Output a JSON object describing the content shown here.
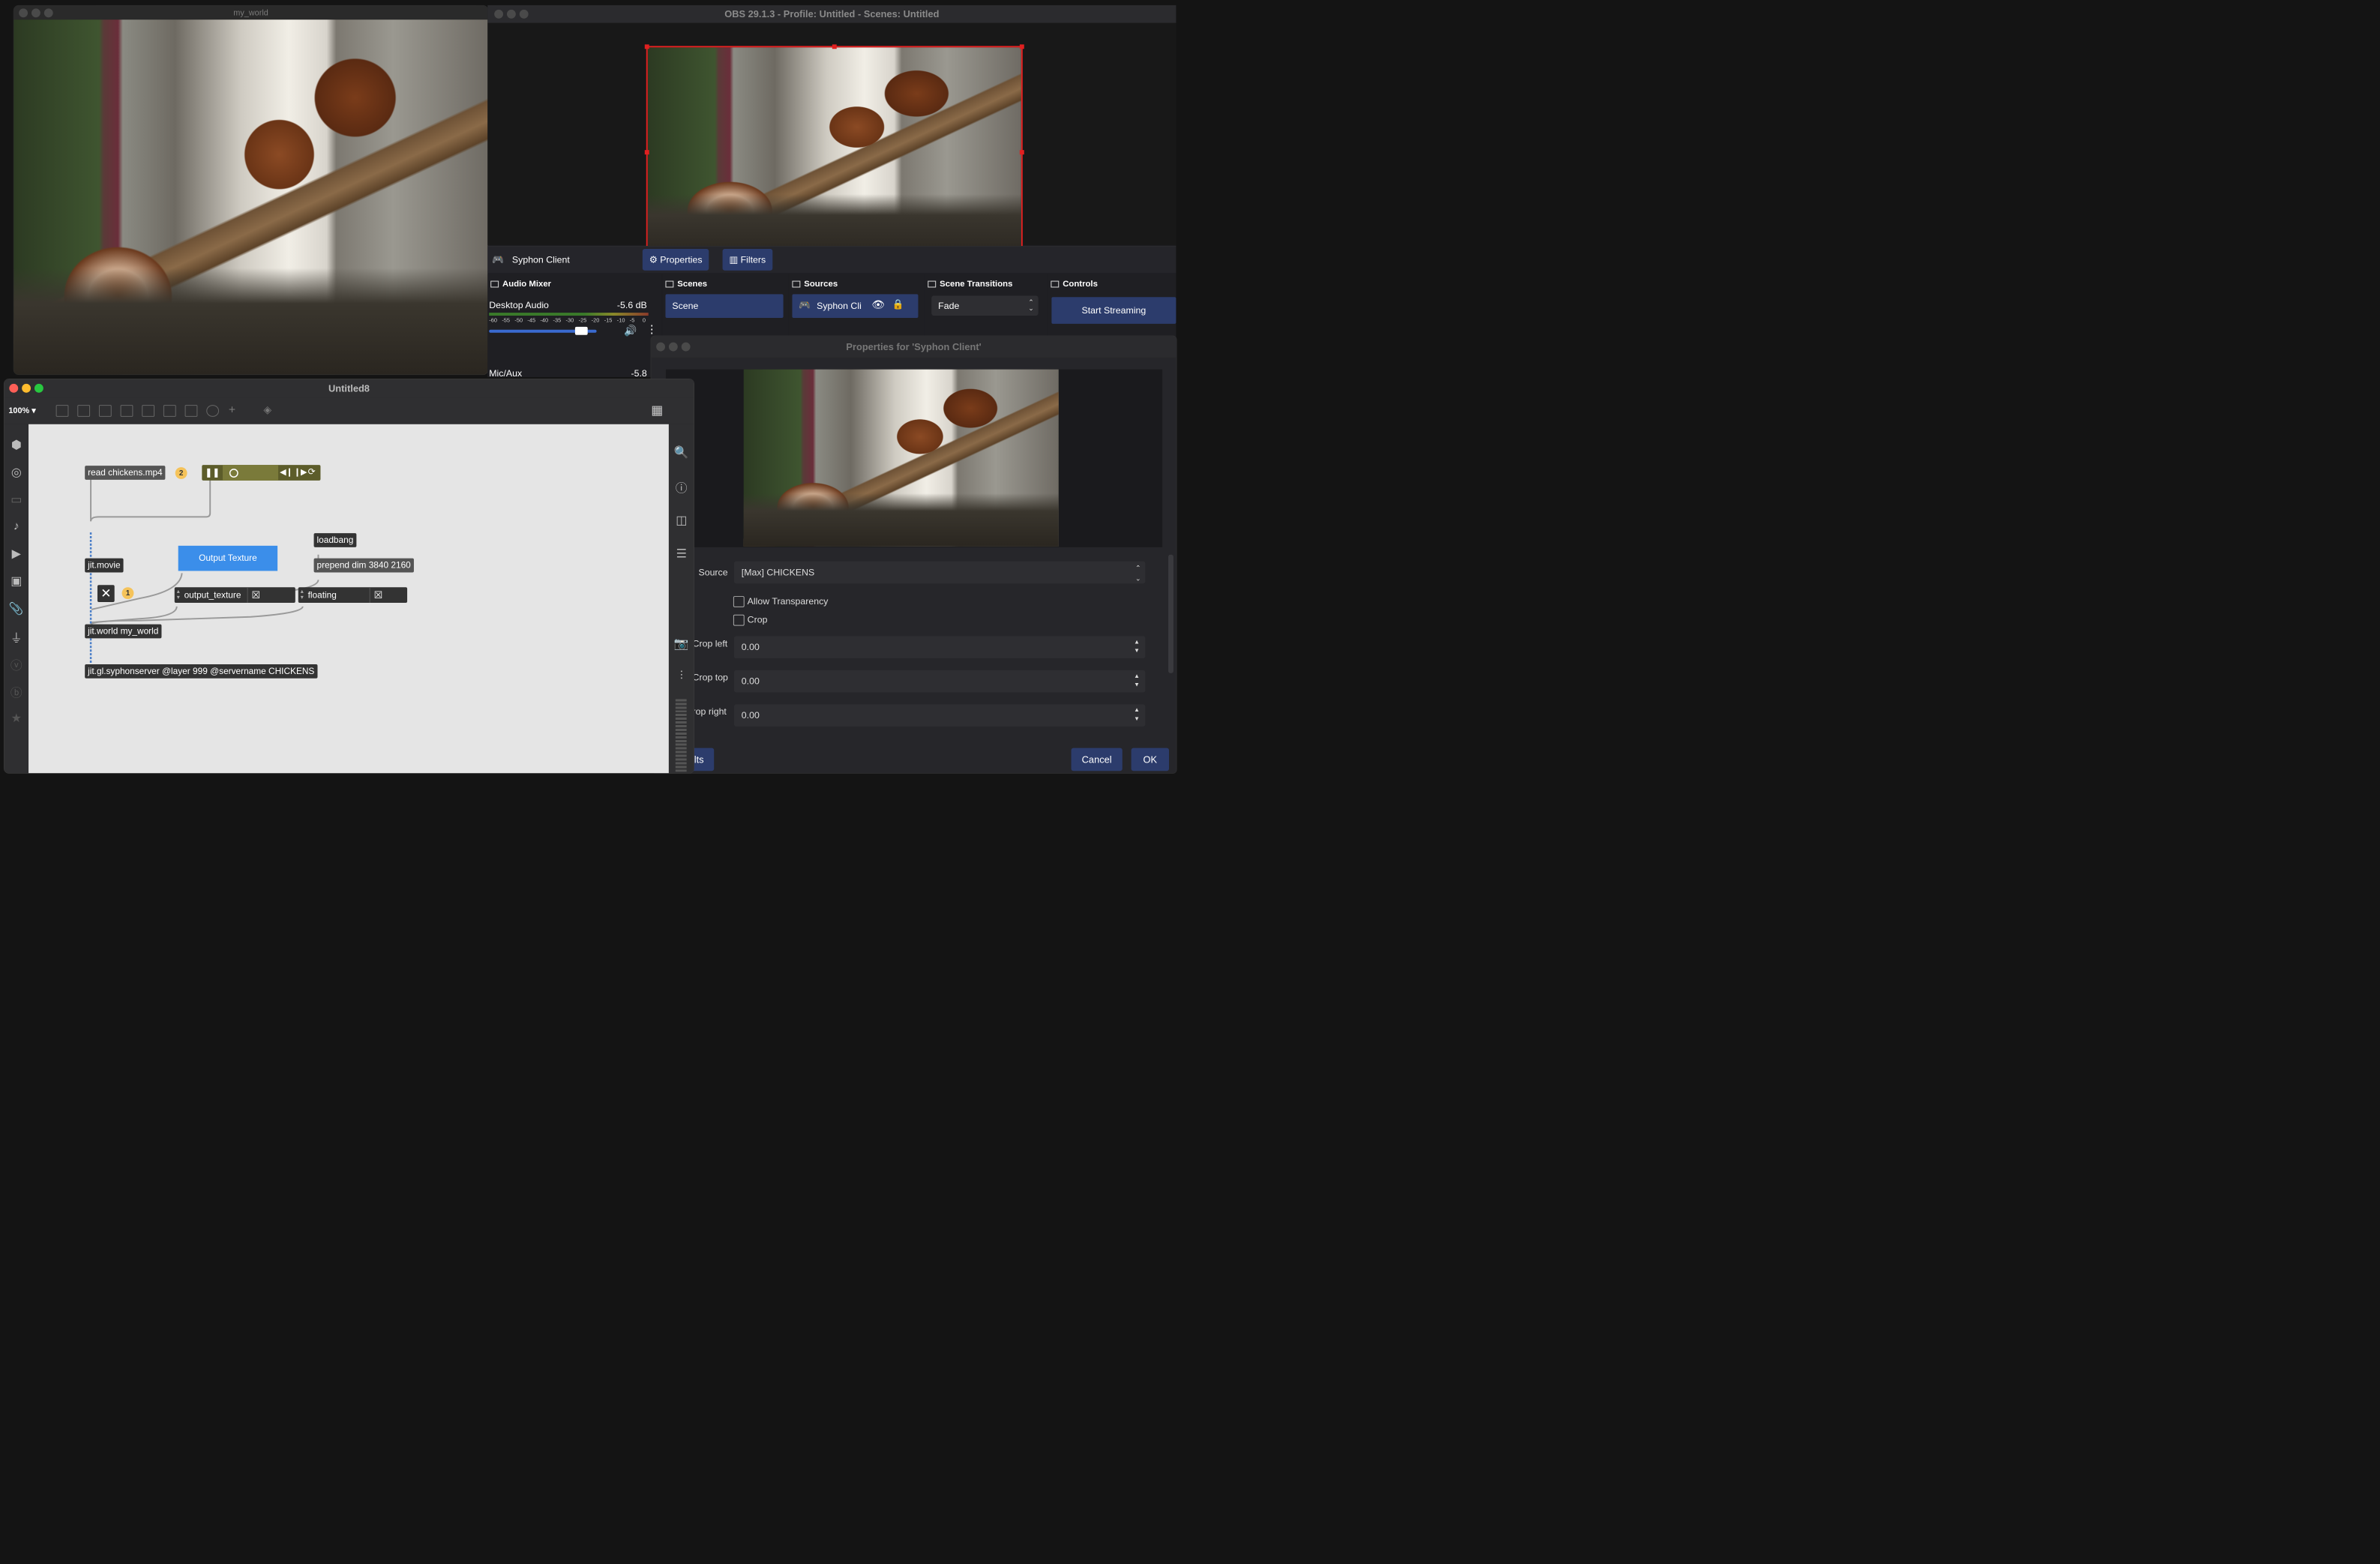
{
  "my_world": {
    "title": "my_world"
  },
  "obs": {
    "title": "OBS 29.1.3 - Profile: Untitled - Scenes: Untitled",
    "source_name": "Syphon Client",
    "properties_label": "Properties",
    "filters_label": "Filters",
    "docks": {
      "audio_mixer": "Audio Mixer",
      "scenes": "Scenes",
      "sources": "Sources",
      "scene_transitions": "Scene Transitions",
      "controls": "Controls"
    },
    "audio": {
      "desktop_label": "Desktop Audio",
      "desktop_db": "-5.6 dB",
      "meter_ticks": [
        "-60",
        "-55",
        "-50",
        "-45",
        "-40",
        "-35",
        "-30",
        "-25",
        "-20",
        "-15",
        "-10",
        "-5",
        "0"
      ],
      "volume_level": 0.83,
      "mic_label": "Mic/Aux",
      "mic_db": "-5.8"
    },
    "scene_item": "Scene",
    "source_item": "Syphon Cli",
    "transition": "Fade",
    "start_streaming": "Start Streaming"
  },
  "props": {
    "title": "Properties for 'Syphon Client'",
    "source_label": "Source",
    "source_value": "[Max] CHICKENS",
    "allow_transparency": "Allow Transparency",
    "crop": "Crop",
    "crop_left_label": "Crop left",
    "crop_left": "0.00",
    "crop_top_label": "Crop top",
    "crop_top": "0.00",
    "crop_right_label": "rop right",
    "crop_right": "0.00",
    "defaults_label": "aults",
    "cancel": "Cancel",
    "ok": "OK"
  },
  "max": {
    "title": "Untitled8",
    "zoom": "100%",
    "objects": {
      "read": "read chickens.mp4",
      "badge2": "2",
      "loadbang": "loadbang",
      "output_texture_btn": "Output Texture",
      "jit_movie": "jit.movie",
      "prepend": "prepend dim 3840 2160",
      "badge1": "1",
      "output_texture_attr": "output_texture",
      "floating": "floating",
      "jit_world": "jit.world my_world",
      "syphon": "jit.gl.syphonserver @layer 999 @servername CHICKENS"
    }
  }
}
